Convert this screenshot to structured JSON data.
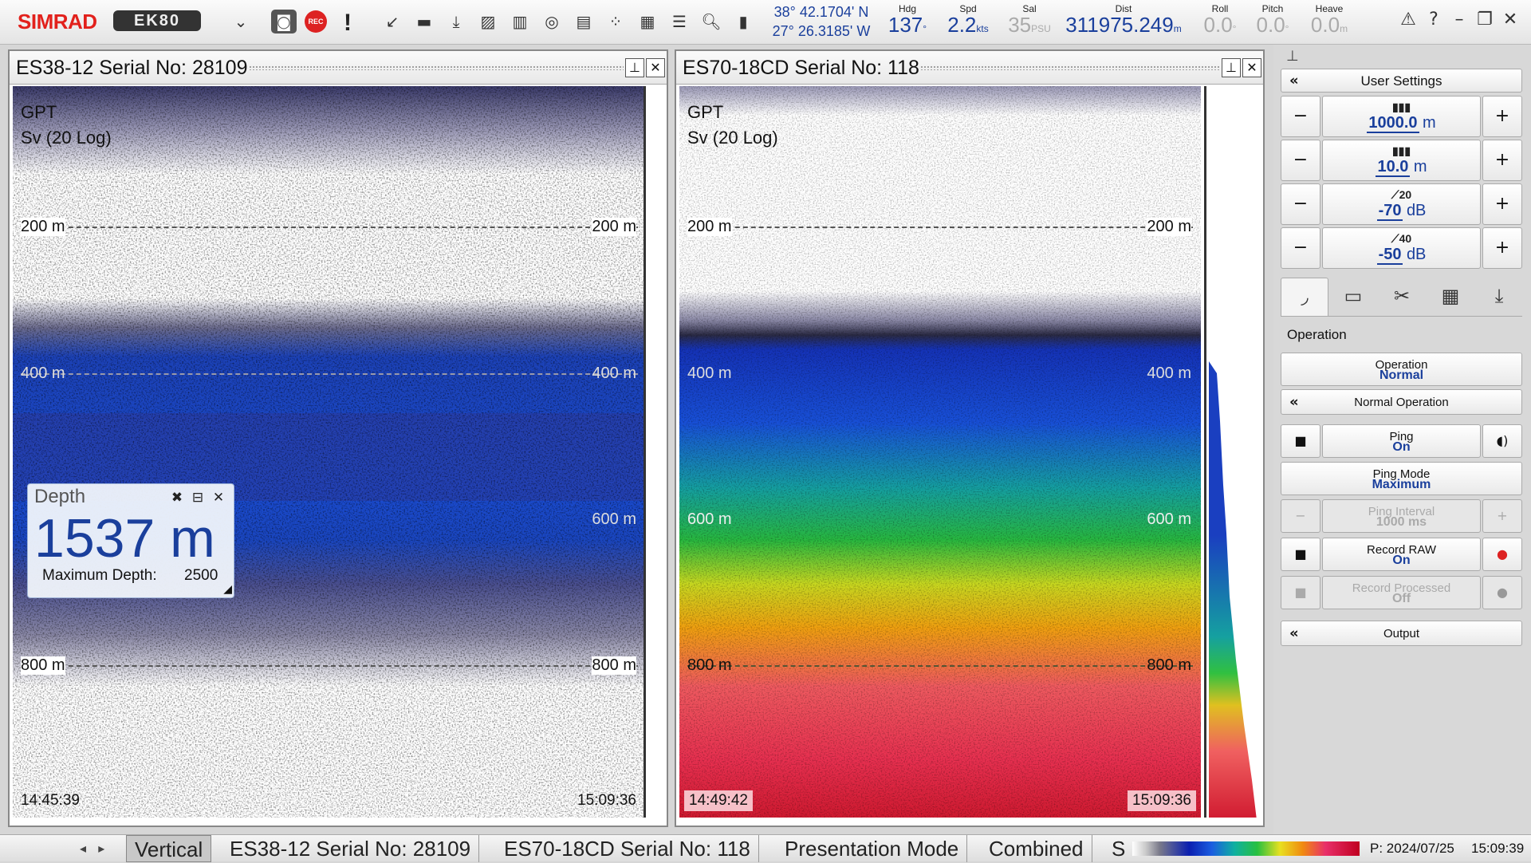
{
  "topbar": {
    "brand": "SIMRAD",
    "product": "EK80",
    "rec_label": "REC",
    "latitude": "38° 42.1704' N",
    "longitude": "27° 26.3185' W",
    "readouts": [
      {
        "label": "Hdg",
        "value": "137",
        "unit": "°",
        "dim": false
      },
      {
        "label": "Spd",
        "value": "2.2",
        "unit": "kts",
        "dim": false
      },
      {
        "label": "Sal",
        "value": "35",
        "unit": "PSU",
        "dim": true
      },
      {
        "label": "Dist",
        "value": "311975.249",
        "unit": "m",
        "dim": false
      },
      {
        "label": "Roll",
        "value": "0.0",
        "unit": "°",
        "dim": true
      },
      {
        "label": "Pitch",
        "value": "0.0",
        "unit": "°",
        "dim": true
      },
      {
        "label": "Heave",
        "value": "0.0",
        "unit": "m",
        "dim": true
      }
    ]
  },
  "panels": [
    {
      "title": "ES38-12 Serial No: 28109",
      "mode": "GPT",
      "variable": "Sv (20 Log)",
      "depth_labels": [
        "200 m",
        "400 m",
        "600 m",
        "800 m"
      ],
      "start_time": "14:45:39",
      "end_time": "15:09:36"
    },
    {
      "title": "ES70-18CD Serial No: 118",
      "mode": "GPT",
      "variable": "Sv (20 Log)",
      "depth_labels": [
        "200 m",
        "400 m",
        "600 m",
        "800 m"
      ],
      "start_time": "14:49:42",
      "end_time": "15:09:36"
    }
  ],
  "depth_window": {
    "title": "Depth",
    "value": "1537 m",
    "max_label": "Maximum Depth:",
    "max_value": "2500"
  },
  "right_panel": {
    "user_settings": "User Settings",
    "range": {
      "value": "1000.0",
      "unit": "m"
    },
    "start_range": {
      "value": "10.0",
      "unit": "m"
    },
    "gain1": {
      "top": "20",
      "value": "-70",
      "unit": "dB"
    },
    "gain2": {
      "top": "40",
      "value": "-50",
      "unit": "dB"
    },
    "section_title": "Operation",
    "operation": {
      "label": "Operation",
      "value": "Normal"
    },
    "normal_operation": "Normal Operation",
    "ping": {
      "label": "Ping",
      "value": "On"
    },
    "ping_mode": {
      "label": "Ping Mode",
      "value": "Maximum"
    },
    "ping_interval": {
      "label": "Ping Interval",
      "value": "1000 ms"
    },
    "record_raw": {
      "label": "Record RAW",
      "value": "On"
    },
    "record_processed": {
      "label": "Record Processed",
      "value": "Off"
    },
    "output": "Output"
  },
  "statusbar": {
    "tabs": [
      "Vertical",
      "ES38-12 Serial No: 28109",
      "ES70-18CD Serial No: 118",
      "Presentation Mode",
      "Combined",
      "S"
    ],
    "ping_date": "P: 2024/07/25",
    "time": "15:09:39"
  },
  "colors": {
    "accent": "#1a3f9c",
    "brand": "#e2211c",
    "rec": "#dd2222"
  }
}
